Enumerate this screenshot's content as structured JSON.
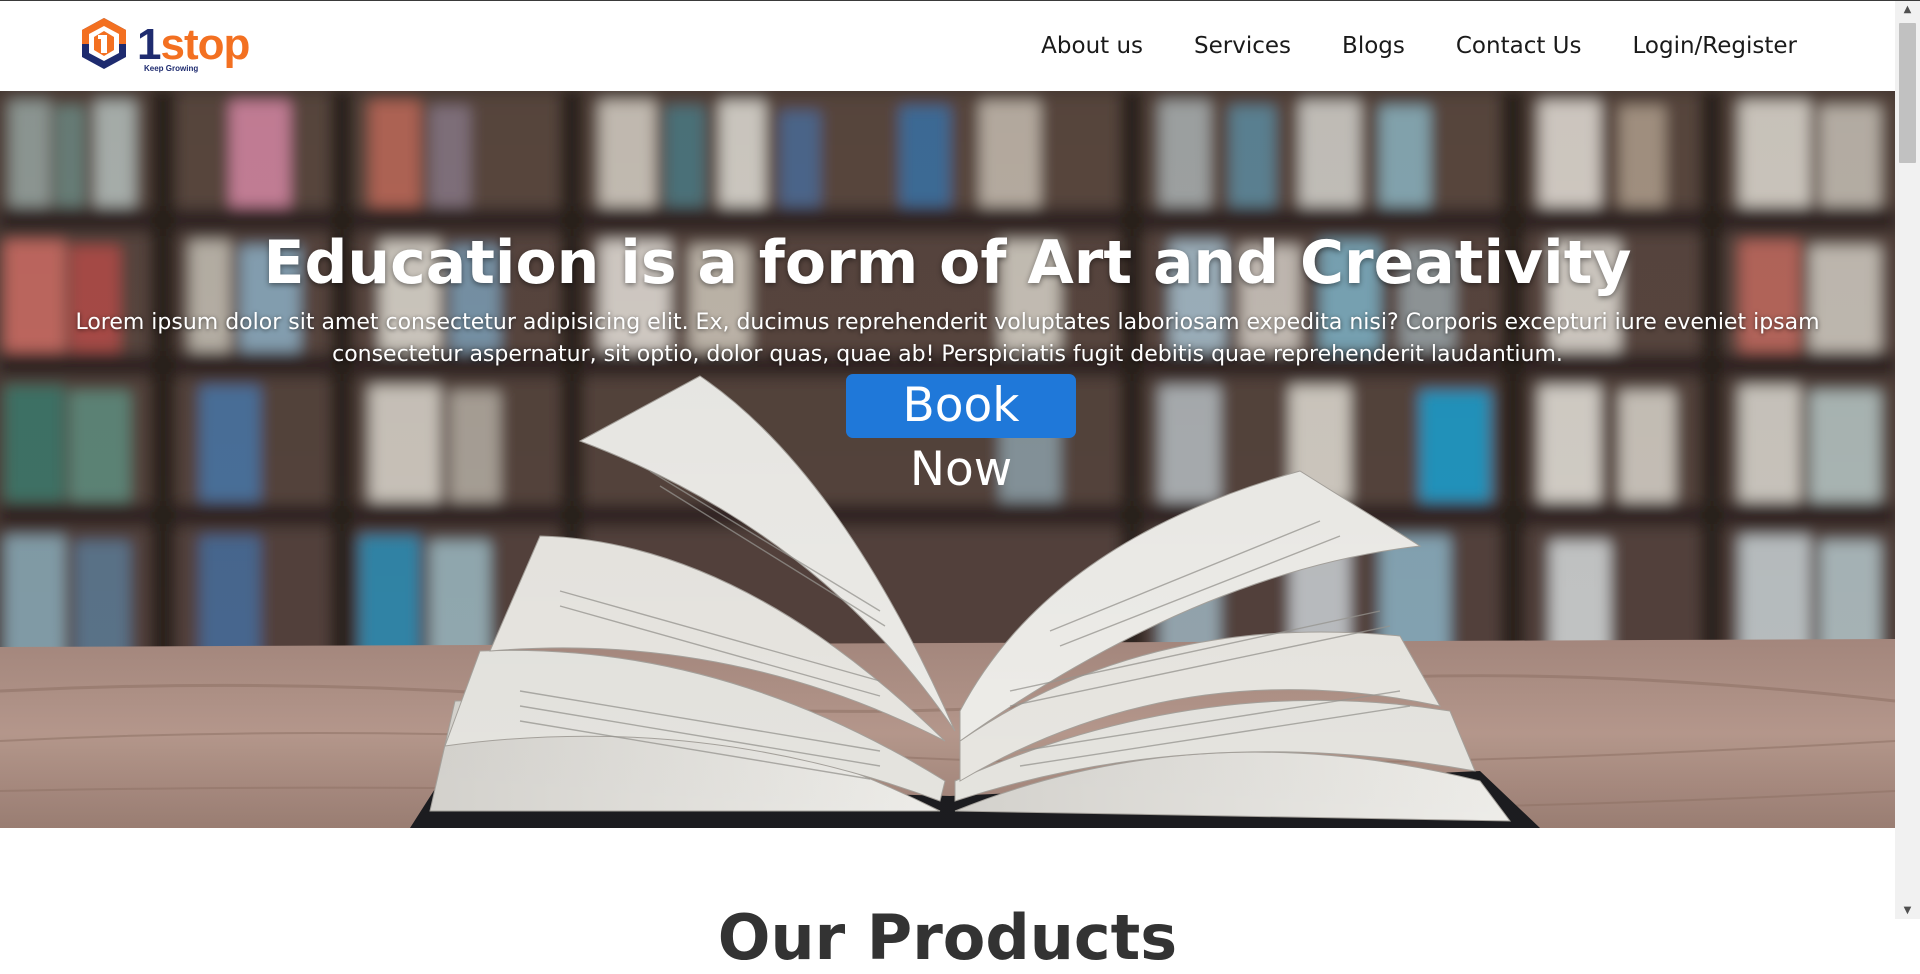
{
  "header": {
    "logo": {
      "mark": "1",
      "word": "stop",
      "tagline": "Keep Growing"
    },
    "nav": [
      {
        "label": "About us"
      },
      {
        "label": "Services"
      },
      {
        "label": "Blogs"
      },
      {
        "label": "Contact Us"
      },
      {
        "label": "Login/Register"
      }
    ]
  },
  "hero": {
    "title": "Education is a form of Art and Creativity",
    "text": "Lorem ipsum dolor sit amet consectetur adipisicing elit. Ex, ducimus reprehenderit voluptates laboriosam expedita nisi? Corporis excepturi iure eveniet ipsam consectetur aspernatur, sit optio, dolor quas, quae ab! Perspiciatis fugit debitis quae reprehenderit laudantium.",
    "cta_label": "Book Now",
    "background_image": "open-book-in-library-photo"
  },
  "products": {
    "title": "Our Products"
  },
  "colors": {
    "brand_orange": "#f37021",
    "brand_navy": "#1e2b6f",
    "button_blue": "#1f78d9",
    "heading_dark": "#333333"
  }
}
